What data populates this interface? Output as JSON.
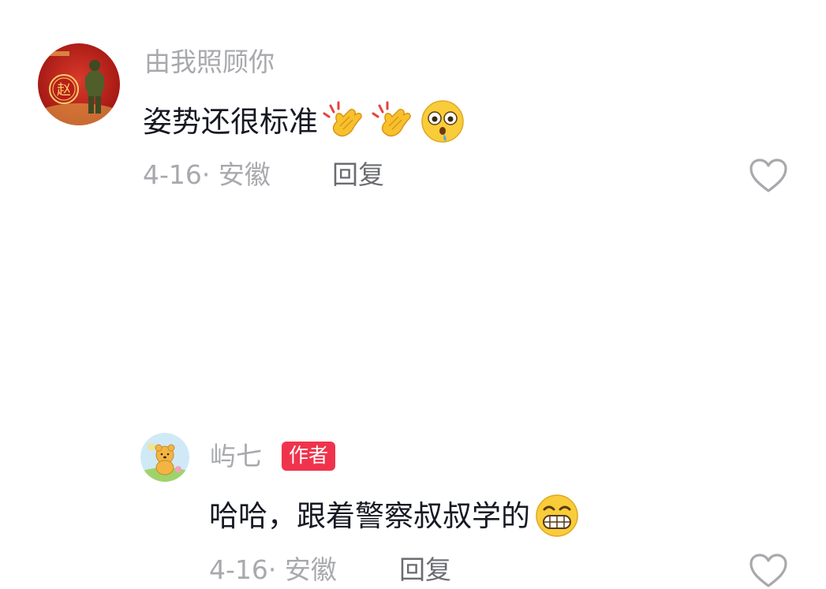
{
  "comments": [
    {
      "avatar_icon": "avatar-soldier-red-seal",
      "avatar_char": "赵",
      "username": "由我照顾你",
      "text": "姿势还很标准",
      "emojis": [
        "clapping-hands-icon",
        "clapping-hands-icon",
        "surprised-face-icon"
      ],
      "meta": "4-16· 安徽",
      "reply_label": "回复",
      "like_icon": "heart-outline-icon"
    },
    {
      "avatar_icon": "avatar-winnie-the-pooh",
      "username": "屿七",
      "badge": "作者",
      "text": "哈哈，跟着警察叔叔学的",
      "emojis": [
        "grinning-face-icon"
      ],
      "meta": "4-16· 安徽",
      "reply_label": "回复",
      "like_icon": "heart-outline-icon"
    }
  ],
  "colors": {
    "badge_bg": "#f0334d",
    "muted": "#a8a9ad",
    "text": "#161823"
  }
}
